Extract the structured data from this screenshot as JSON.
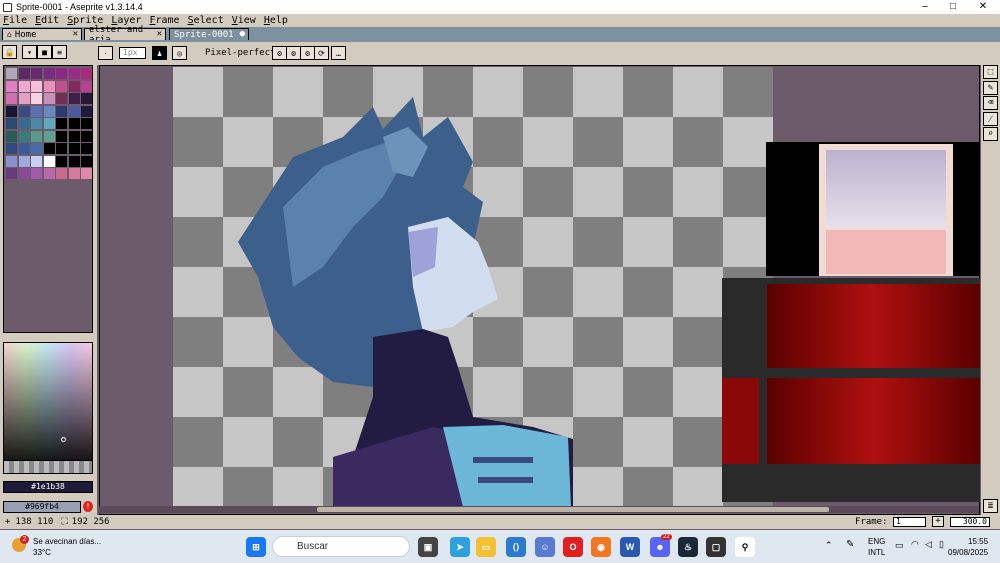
{
  "window": {
    "title": "Sprite-0001 - Aseprite v1.3.14.4",
    "minimize": "–",
    "maximize": "□",
    "close": "✕"
  },
  "menu": [
    "File",
    "Edit",
    "Sprite",
    "Layer",
    "Frame",
    "Select",
    "View",
    "Help"
  ],
  "tabs": [
    {
      "label": "Home",
      "close": "✕"
    },
    {
      "label": "elster and aria",
      "close": "✕"
    },
    {
      "label": "Sprite-0001",
      "close": "●"
    }
  ],
  "toolbar": {
    "brush_size": "1px",
    "pixel_perfect": "Pixel-perfect"
  },
  "palette": {
    "colors": [
      "#b0a8b8",
      "#5a2a60",
      "#6a2870",
      "#7a2a80",
      "#8a2880",
      "#9c2a88",
      "#aa2a7a",
      "#e080c0",
      "#f0a8d0",
      "#f8c0d8",
      "#e890b8",
      "#c05090",
      "#802a60",
      "#b84090",
      "#d070b0",
      "#e0a0c8",
      "#f8d0e0",
      "#c890b8",
      "#703050",
      "#40204a",
      "#2a183a",
      "#1a1630",
      "#3a4a80",
      "#5a70b0",
      "#6a88c0",
      "#2a3a70",
      "#4a5aa0",
      "#1e1b3a",
      "#2a4a70",
      "#3a6a90",
      "#4a8aa8",
      "#60a8c0",
      "#000000",
      "#000000",
      "#000000",
      "#2a5a5a",
      "#3a7a7a",
      "#5a9a8a",
      "#60a090",
      "#000000",
      "#000000",
      "#000000",
      "#304a80",
      "#3a5a98",
      "#4a6aa8",
      "#000000",
      "#000000",
      "#000000",
      "#000000",
      "#8a90d0",
      "#a0a8e0",
      "#c8d0f0",
      "#ffffff",
      "#000000",
      "#000000",
      "#000000",
      "#6a3a80",
      "#8a4a98",
      "#a05aa8",
      "#b86aa8",
      "#c86a90",
      "#d87aa0",
      "#e08aa8"
    ],
    "fg_hex": "#1e1b38",
    "bg_hex": "#969fb4"
  },
  "status": {
    "cursor_label": "138 110",
    "selection_label": "192 256",
    "frame_label": "Frame:",
    "frame_value": "1",
    "add_frame": "+",
    "zoom": "300.0"
  },
  "taskbar": {
    "weather_text": "Se avecinan días...",
    "weather_temp": "33°C",
    "weather_badge": "2",
    "search_placeholder": "Buscar",
    "lang_1": "ENG",
    "lang_2": "INTL",
    "time": "15:55",
    "date": "09/08/2025",
    "badge_count": "22"
  },
  "colors": {
    "ui_bg": "#d3cbbe",
    "tab_bar": "#7d929e",
    "workspace": "#6b5b6b",
    "accent_warning": "#e32020"
  }
}
